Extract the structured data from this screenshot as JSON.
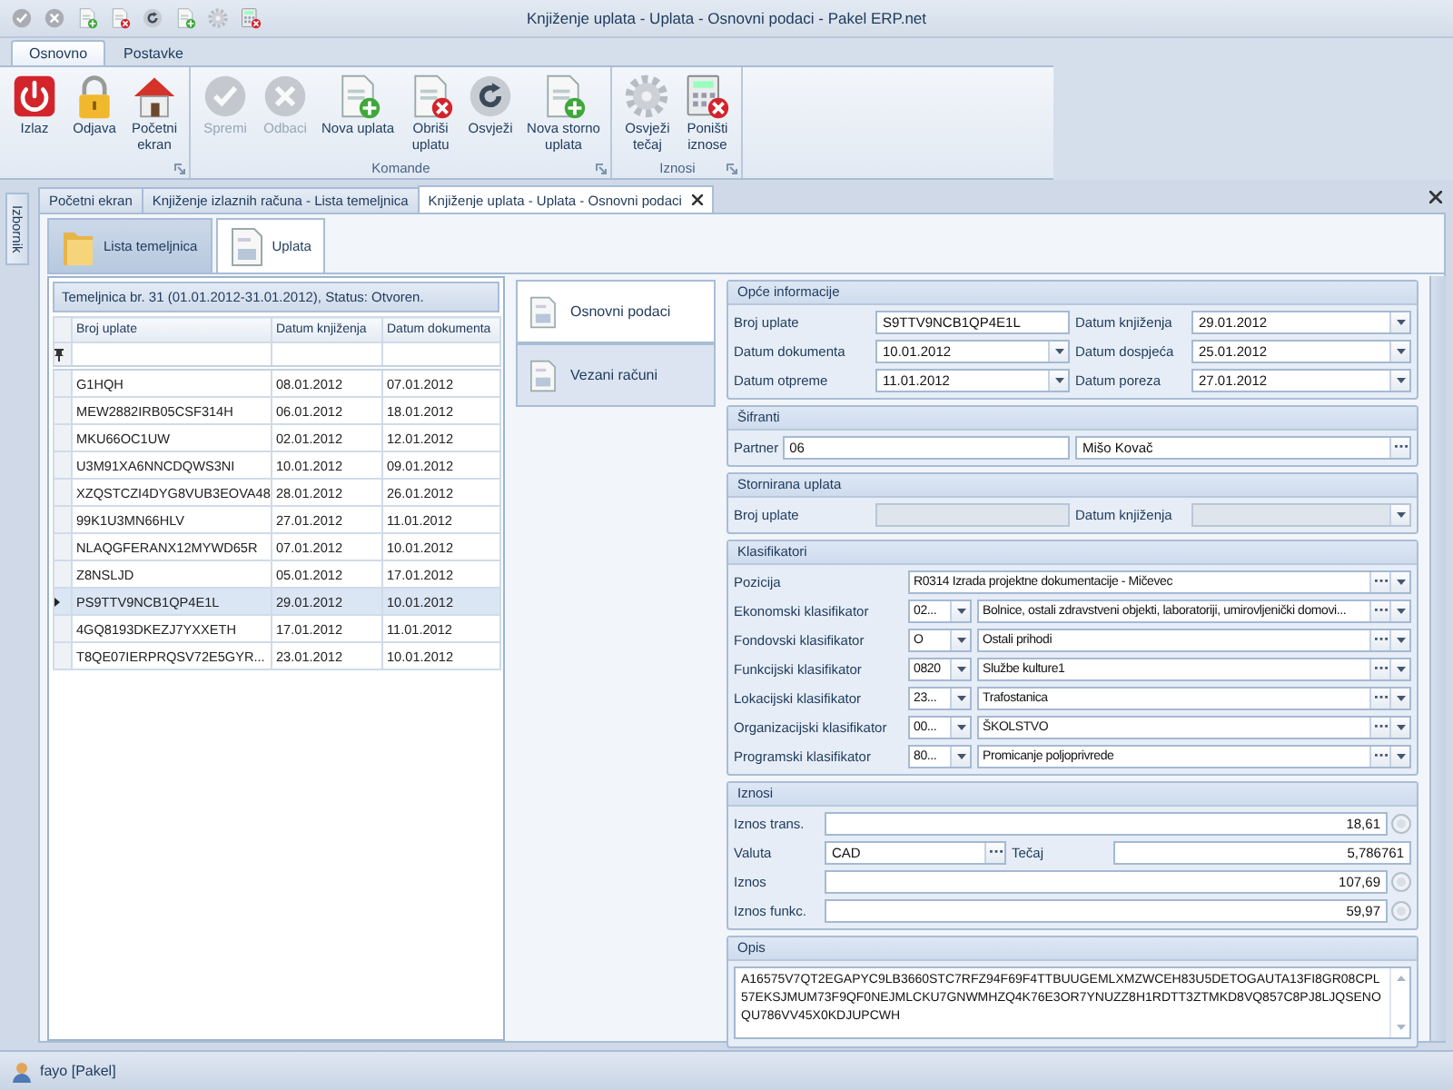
{
  "window": {
    "title": "Knjiženje uplata - Uplata - Osnovni podaci - Pakel ERP.net"
  },
  "ribbon": {
    "tabs": [
      {
        "label": "Osnovno",
        "selected": true
      },
      {
        "label": "Postavke",
        "selected": false
      }
    ],
    "groups": [
      {
        "buttons": [
          {
            "kind": "exit",
            "label": "Izlaz",
            "disabled": false
          },
          {
            "kind": "lock",
            "label": "Odjava",
            "disabled": false
          },
          {
            "kind": "home",
            "label": "Početni\nekran",
            "disabled": false
          }
        ]
      },
      {
        "title": "Komande",
        "buttons": [
          {
            "kind": "save",
            "label": "Spremi",
            "disabled": true
          },
          {
            "kind": "cancel",
            "label": "Odbaci",
            "disabled": true
          },
          {
            "kind": "new",
            "label": "Nova uplata",
            "disabled": false
          },
          {
            "kind": "delete",
            "label": "Obriši\nuplatu",
            "disabled": false
          },
          {
            "kind": "refresh",
            "label": "Osvježi",
            "disabled": false
          },
          {
            "kind": "new",
            "label": "Nova storno\nuplata",
            "disabled": false
          }
        ]
      },
      {
        "title": "Iznosi",
        "buttons": [
          {
            "kind": "gear",
            "label": "Osvježi\ntečaj",
            "disabled": false
          },
          {
            "kind": "calc",
            "label": "Poništi\niznose",
            "disabled": false
          }
        ]
      }
    ]
  },
  "side_panel": {
    "label": "Izbornik"
  },
  "doc_tabs": [
    {
      "label": "Početni ekran",
      "selected": false
    },
    {
      "label": "Knjiženje izlaznih računa - Lista temeljnica",
      "selected": false
    },
    {
      "label": "Knjiženje uplata - Uplata - Osnovni podaci",
      "selected": true
    }
  ],
  "view_tabs": [
    {
      "kind": "folder",
      "label": "Lista temeljnica",
      "selected": false
    },
    {
      "kind": "form",
      "label": "Uplata",
      "selected": true
    }
  ],
  "grid": {
    "caption": "Temeljnica br. 31 (01.01.2012-31.01.2012), Status: Otvoren.",
    "columns": [
      "Broj uplate",
      "Datum knjiženja",
      "Datum dokumenta"
    ],
    "rows": [
      {
        "cells": [
          "G1HQH",
          "08.01.2012",
          "07.01.2012"
        ],
        "selected": false
      },
      {
        "cells": [
          "MEW2882IRB05CSF314H",
          "06.01.2012",
          "18.01.2012"
        ],
        "selected": false
      },
      {
        "cells": [
          "MKU66OC1UW",
          "02.01.2012",
          "12.01.2012"
        ],
        "selected": false
      },
      {
        "cells": [
          "U3M91XA6NNCDQWS3NI",
          "10.01.2012",
          "09.01.2012"
        ],
        "selected": false
      },
      {
        "cells": [
          "XZQSTCZI4DYG8VUB3EOVA48",
          "28.01.2012",
          "26.01.2012"
        ],
        "selected": false
      },
      {
        "cells": [
          "99K1U3MN66HLV",
          "27.01.2012",
          "11.01.2012"
        ],
        "selected": false
      },
      {
        "cells": [
          "NLAQGFERANX12MYWD65R",
          "07.01.2012",
          "10.01.2012"
        ],
        "selected": false
      },
      {
        "cells": [
          "Z8NSLJD",
          "05.01.2012",
          "17.01.2012"
        ],
        "selected": false
      },
      {
        "cells": [
          "PS9TTV9NCB1QP4E1L",
          "29.01.2012",
          "10.01.2012"
        ],
        "selected": true
      },
      {
        "cells": [
          "4GQ8193DKEZJ7YXXETH",
          "17.01.2012",
          "11.01.2012"
        ],
        "selected": false
      },
      {
        "cells": [
          "T8QE07IERPRQSV72E5GYR...",
          "23.01.2012",
          "10.01.2012"
        ],
        "selected": false
      }
    ]
  },
  "nav": [
    {
      "label": "Osnovni podaci",
      "selected": true
    },
    {
      "label": "Vezani računi",
      "selected": false
    }
  ],
  "form": [
    {
      "title": "Opće informacije",
      "kind": "pairs",
      "rows": [
        [
          {
            "label": "Broj uplate",
            "value": "S9TTV9NCB1QP4E1L",
            "kind": "text",
            "disabled": false
          },
          {
            "label": "Datum knjiženja",
            "value": "29.01.2012",
            "kind": "date",
            "disabled": false
          }
        ],
        [
          {
            "label": "Datum dokumenta",
            "value": "10.01.2012",
            "kind": "date",
            "disabled": false
          },
          {
            "label": "Datum dospjeća",
            "value": "25.01.2012",
            "kind": "date",
            "disabled": false
          }
        ],
        [
          {
            "label": "Datum otpreme",
            "value": "11.01.2012",
            "kind": "date",
            "disabled": false
          },
          {
            "label": "Datum poreza",
            "value": "27.01.2012",
            "kind": "date",
            "disabled": false
          }
        ]
      ]
    },
    {
      "title": "Šifranti",
      "kind": "partner",
      "rows": [
        [
          {
            "label": "Partner",
            "value": "06",
            "kind": "text",
            "disabled": false
          },
          {
            "value": "Mišo Kovač",
            "kind": "lookup",
            "disabled": false
          }
        ]
      ]
    },
    {
      "title": "Stornirana uplata",
      "kind": "pairs",
      "rows": [
        [
          {
            "label": "Broj uplate",
            "kind": "text",
            "disabled": true
          },
          {
            "label": "Datum knjiženja",
            "kind": "date",
            "disabled": true
          }
        ]
      ]
    },
    {
      "title": "Klasifikatori",
      "kind": "classifiers",
      "rows": [
        [
          {
            "label": "Pozicija",
            "value": "R0314 Izrada projektne dokumentacije - Mičevec",
            "kind": "lookup-combo",
            "disabled": false
          }
        ],
        [
          {
            "label": "Ekonomski klasifikator",
            "value": "02...",
            "kind": "combo",
            "disabled": false
          },
          {
            "value": "Bolnice, ostali zdravstveni objekti, laboratoriji, umirovljenički domovi...",
            "kind": "lookup-combo",
            "disabled": false
          }
        ],
        [
          {
            "label": "Fondovski klasifikator",
            "value": "O",
            "kind": "combo",
            "disabled": false
          },
          {
            "value": "Ostali prihodi",
            "kind": "lookup-combo",
            "disabled": false
          }
        ],
        [
          {
            "label": "Funkcijski klasifikator",
            "value": "0820",
            "kind": "combo",
            "disabled": false
          },
          {
            "value": "Službe kulture1",
            "kind": "lookup-combo",
            "disabled": false
          }
        ],
        [
          {
            "label": "Lokacijski klasifikator",
            "value": "23...",
            "kind": "combo",
            "disabled": false
          },
          {
            "value": "Trafostanica",
            "kind": "lookup-combo",
            "disabled": false
          }
        ],
        [
          {
            "label": "Organizacijski klasifikator",
            "value": "00...",
            "kind": "combo",
            "disabled": false
          },
          {
            "value": "ŠKOLSTVO",
            "kind": "lookup-combo",
            "disabled": false
          }
        ],
        [
          {
            "label": "Programski klasifikator",
            "value": "80...",
            "kind": "combo",
            "disabled": false
          },
          {
            "value": "Promicanje poljoprivrede",
            "kind": "lookup-combo",
            "disabled": false
          }
        ]
      ]
    },
    {
      "title": "Iznosi",
      "kind": "amounts",
      "rows": [
        [
          {
            "label": "Iznos trans.",
            "value": "18,61",
            "kind": "amount",
            "disabled": false
          }
        ],
        [
          {
            "label": "Valuta",
            "value": "CAD",
            "kind": "lookup",
            "disabled": false
          },
          {
            "label": "Tečaj",
            "value": "5,786761",
            "kind": "number",
            "disabled": false
          }
        ],
        [
          {
            "label": "Iznos",
            "value": "107,69",
            "kind": "amount",
            "disabled": false
          }
        ],
        [
          {
            "label": "Iznos funkc.",
            "value": "59,97",
            "kind": "amount",
            "disabled": false
          }
        ]
      ]
    },
    {
      "title": "Opis",
      "kind": "memo",
      "rows": [
        [
          {
            "value": "A16575V7QT2EGAPYC9LB3660STC7RFZ94F69F4TTBUUGEMLXMZWCEH83U5DETOGAUTA13FI8GR08CPL57EKSJMUM73F9QF0NEJMLCKU7GNWMHZQ4K76E3OR7YNUZZ8H1RDTT3ZTMKD8VQ857C8PJ8LJQSENOQU786VV45X0KDJUPCWH",
            "kind": "memo",
            "disabled": false
          }
        ]
      ]
    }
  ],
  "status_bar": {
    "user": "fayo [Pakel]"
  }
}
